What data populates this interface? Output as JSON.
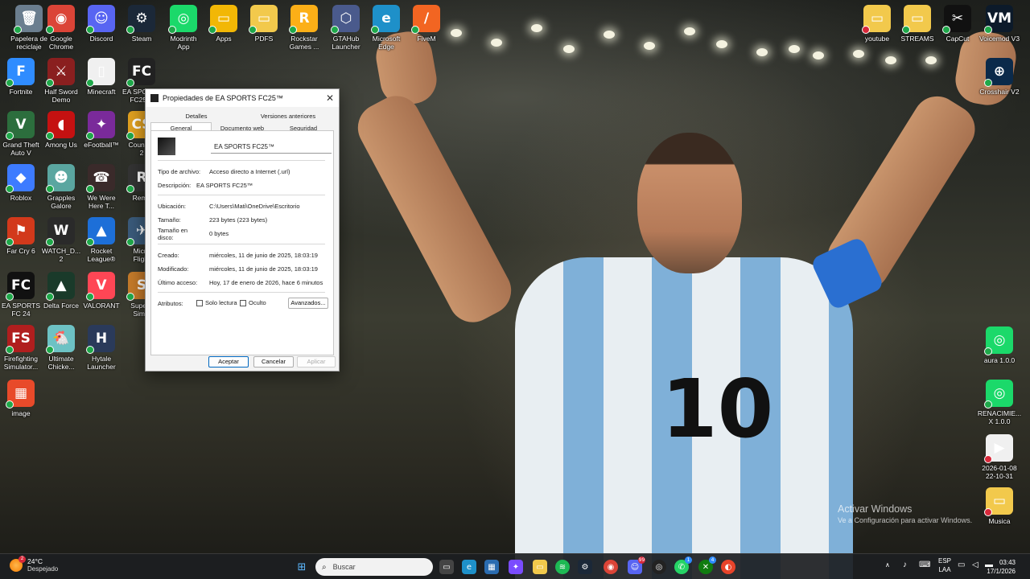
{
  "desktop": {
    "icons": [
      {
        "label": "Papelera de\nreciclaje",
        "glyph": "🗑",
        "color": "#6b7e8f"
      },
      {
        "label": "Google\nChrome",
        "glyph": "◉",
        "color": "#db4437"
      },
      {
        "label": "Discord",
        "glyph": "☺",
        "color": "#5865f2"
      },
      {
        "label": "Steam",
        "glyph": "⚙",
        "color": "#1b2838"
      },
      {
        "label": "Modrinth\nApp",
        "glyph": "◎",
        "color": "#1bd96a"
      },
      {
        "label": "Apps",
        "glyph": "▭",
        "color": "#f2b705"
      },
      {
        "label": "PDFS",
        "glyph": "▭",
        "color": "#f2c94c"
      },
      {
        "label": "Rockstar\nGames ...",
        "glyph": "R",
        "color": "#fcaf17"
      },
      {
        "label": "GTAHub\nLauncher",
        "glyph": "⬡",
        "color": "#4a5a8c"
      },
      {
        "label": "Microsoft\nEdge",
        "glyph": "e",
        "color": "#1e90c9"
      },
      {
        "label": "FiveM",
        "glyph": "/",
        "color": "#f26522"
      },
      {
        "label": "Fortnite",
        "glyph": "F",
        "color": "#2f8cff"
      },
      {
        "label": "Half Sword\nDemo",
        "glyph": "⚔",
        "color": "#8a1f1f"
      },
      {
        "label": "Minecraft",
        "glyph": "▯",
        "color": "#f0f0f0"
      },
      {
        "label": "EA SPORTS\nFC25™",
        "glyph": "FC",
        "color": "#222222"
      },
      {
        "label": "Grand Theft\nAuto V",
        "glyph": "V",
        "color": "#2c6e3d"
      },
      {
        "label": "Among Us",
        "glyph": "◖",
        "color": "#c51111"
      },
      {
        "label": "eFootball™",
        "glyph": "✦",
        "color": "#7a2a9a"
      },
      {
        "label": "Counter-\n2",
        "glyph": "CS",
        "color": "#e0a020"
      },
      {
        "label": "Roblox",
        "glyph": "◆",
        "color": "#3d7bff"
      },
      {
        "label": "Grapples\nGalore",
        "glyph": "☻",
        "color": "#5aa6a0"
      },
      {
        "label": "We Were\nHere T...",
        "glyph": "☎",
        "color": "#3a2a2a"
      },
      {
        "label": "Rema",
        "glyph": "R",
        "color": "#333333"
      },
      {
        "label": "Far Cry 6",
        "glyph": "⚑",
        "color": "#d2391b"
      },
      {
        "label": "WATCH_D...\n2",
        "glyph": "W",
        "color": "#2a2a2a"
      },
      {
        "label": "Rocket\nLeague®",
        "glyph": "▲",
        "color": "#1d6fd8"
      },
      {
        "label": "Micro\nFlight",
        "glyph": "✈",
        "color": "#3a5a7a"
      },
      {
        "label": "EA SPORTS\nFC 24",
        "glyph": "FC",
        "color": "#111111"
      },
      {
        "label": "Delta Force",
        "glyph": "▲",
        "color": "#1a3a2a"
      },
      {
        "label": "VALORANT",
        "glyph": "V",
        "color": "#ff4655"
      },
      {
        "label": "Supern\nSimul",
        "glyph": "S",
        "color": "#c47a2a"
      },
      {
        "label": "Firefighting\nSimulator...",
        "glyph": "FS",
        "color": "#b01e1e"
      },
      {
        "label": "Ultimate\nChicke...",
        "glyph": "🐔",
        "color": "#6dc2c4"
      },
      {
        "label": "Hytale\nLauncher",
        "glyph": "H",
        "color": "#2a3a5a"
      },
      {
        "label": "image",
        "glyph": "▦",
        "color": "#e84a2a"
      },
      {
        "label": "youtube",
        "glyph": "▭",
        "color": "#f2c94c"
      },
      {
        "label": "STREAMS",
        "glyph": "▭",
        "color": "#f2c94c"
      },
      {
        "label": "CapCut",
        "glyph": "✂",
        "color": "#111111"
      },
      {
        "label": "Voicemod V3",
        "glyph": "VM",
        "color": "#0c1a2a"
      },
      {
        "label": "Crosshair V2",
        "glyph": "⊕",
        "color": "#0b2a4a"
      },
      {
        "label": "aura 1.0.0",
        "glyph": "◎",
        "color": "#1bd96a"
      },
      {
        "label": "RENACIMIE...\nX 1.0.0",
        "glyph": "◎",
        "color": "#1bd96a"
      },
      {
        "label": "2026-01-08\n22-10-31",
        "glyph": "▶",
        "color": "#f0f0f0"
      },
      {
        "label": "Musica",
        "glyph": "▭",
        "color": "#f2c94c"
      }
    ],
    "activate": {
      "title": "Activar Windows",
      "subtitle": "Ve a Configuración para activar Windows."
    }
  },
  "dialog": {
    "title": "Propiedades de EA SPORTS FC25™",
    "tabs_top": [
      "Detalles",
      "Versiones anteriores"
    ],
    "tabs_bottom": [
      "General",
      "Documento web",
      "Seguridad"
    ],
    "active_tab": "General",
    "name": "EA SPORTS FC25™",
    "tipo_label": "Tipo de archivo:",
    "tipo_value": "Acceso directo a Internet (.url)",
    "desc_label": "Descripción:",
    "desc_value": "EA SPORTS FC25™",
    "ubic_label": "Ubicación:",
    "ubic_value": "C:\\Users\\Mati\\OneDrive\\Escritorio",
    "tam_label": "Tamaño:",
    "tam_value": "223 bytes (223 bytes)",
    "tamdisco_label": "Tamaño en\ndisco:",
    "tamdisco_value": "0 bytes",
    "creado_label": "Creado:",
    "creado_value": "miércoles, 11 de junio de 2025, 18:03:19",
    "mod_label": "Modificado:",
    "mod_value": "miércoles, 11 de junio de 2025, 18:03:19",
    "acceso_label": "Último acceso:",
    "acceso_value": "Hoy, 17 de enero de 2026, hace 6 minutos",
    "attr_label": "Atributos:",
    "solo_lectura": "Solo lectura",
    "oculto": "Oculto",
    "avanzados": "Avanzados...",
    "aceptar": "Aceptar",
    "cancelar": "Cancelar",
    "aplicar": "Aplicar"
  },
  "taskbar": {
    "temp": "24°C",
    "weather": "Despejado",
    "search_placeholder": "Buscar",
    "lang": "ESP",
    "lang2": "LAA",
    "time": "03:43",
    "date": "17/1/2026",
    "badges": {
      "weather": "2",
      "discord": "99",
      "whatsapp": "1",
      "xbox": "4"
    }
  }
}
